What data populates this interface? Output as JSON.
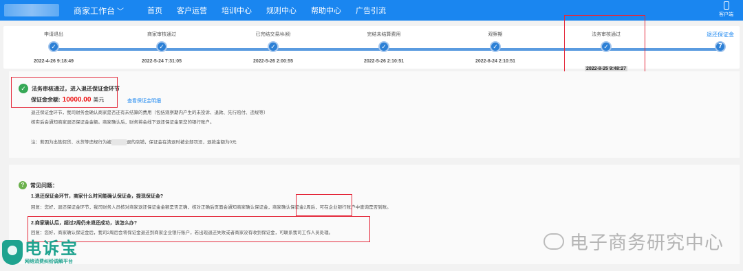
{
  "nav": {
    "workspace": "商家工作台",
    "links": [
      "首页",
      "客户运营",
      "培训中心",
      "规则中心",
      "帮助中心",
      "广告引流"
    ],
    "customer_service": "客户端"
  },
  "timeline": {
    "steps": [
      {
        "label": "申请退出",
        "time": "2022-4-26 9:18:49",
        "mark": "✓"
      },
      {
        "label": "商家审核通过",
        "time": "2022-5-24 7:31:05",
        "mark": "✓"
      },
      {
        "label": "已完结交易/纠纷",
        "time": "2022-5-26 2:00:55",
        "mark": "✓"
      },
      {
        "label": "完结未结算费用",
        "time": "2022-5-26 2:10:51",
        "mark": "✓"
      },
      {
        "label": "观察期",
        "time": "2022-8-24 2:10:51",
        "mark": "✓"
      },
      {
        "label": "法务审核通过",
        "time": "2022-8-25 9:48:27",
        "mark": "✓"
      },
      {
        "label": "退还保证金",
        "time": "",
        "mark": "7"
      }
    ]
  },
  "status": {
    "title": "法务审核通过，进入退还保证金环节",
    "deposit_label": "保证金余额:",
    "deposit_amount": "10000.00",
    "deposit_currency": "美元",
    "view_link": "查看保证金明细",
    "line1": "退还保证金环节，我司财务会确认商家是否还有未结算的费用（包括观察期内产生的未投诉、退款、先行赔付、违规等）",
    "line2": "核实后会通知商家退还保证金金额。商家确认后，财务将会线下退还保证金至您的银行账户。",
    "note_prefix": "注：若因为出售假货、水货等违规行为被",
    "note_suffix": "退的店铺，保证金在清退时被全部罚没，退款金额为0元"
  },
  "faq": {
    "heading": "常见问题：",
    "q1": "1.退还保证金环节，商家什么时间能确认保证金，提现保证金?",
    "a1": "回复：您好，退还保证金环节，我司财务人员核对商家退还保证金金额是否正确，核对正确后页面会通知商家确认保证金，商家确认保证金2周后，可在企业银行账户中查询是否到账。",
    "q2": "2.商家确认后，超过2周仍未退还成功，该怎么办?",
    "a2": "回复：您好，商家确认保证金后，我司2周后会将保证金退还到商家企业银行账户，若出现退还失败或者商家没有收到保证金，可联系我司工作人员处理。"
  },
  "watermark": {
    "text": "电子商务研究中心"
  },
  "logo": {
    "name": "电诉宝",
    "slogan": "网络消费纠纷调解平台"
  }
}
